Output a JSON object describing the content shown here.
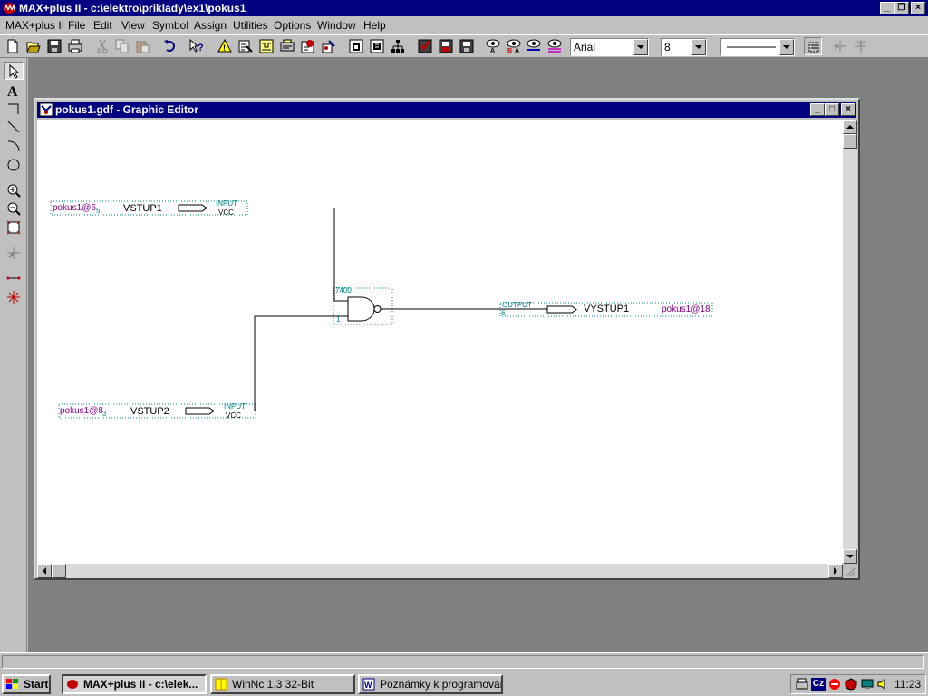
{
  "app": {
    "title": "MAX+plus II - c:\\elektro\\priklady\\ex1\\pokus1"
  },
  "menu": [
    "MAX+plus II",
    "File",
    "Edit",
    "View",
    "Symbol",
    "Assign",
    "Utilities",
    "Options",
    "Window",
    "Help"
  ],
  "toolbar": {
    "font_name": "Arial",
    "font_size": "8",
    "icons": [
      "new-file-icon",
      "open-file-icon",
      "save-icon",
      "print-icon",
      "cut-icon",
      "copy-icon",
      "paste-icon",
      "undo-icon",
      "context-help-icon",
      "compiler-icon",
      "simulator-icon",
      "timing-analyzer-icon",
      "programmer-icon",
      "open-editor-icon",
      "hierarchy-up-icon",
      "hierarchy-down-icon",
      "hierarchy-display-icon",
      "save-check-icon",
      "save-compile-icon",
      "save-simulate-icon",
      "find-node-icon",
      "find-node-design-file-icon",
      "find-node-floorplan-icon",
      "find-node-waveform-icon",
      "line-style-icon",
      "rotate-icon",
      "flip-horizontal-icon",
      "flip-vertical-icon"
    ]
  },
  "palette": {
    "tools": [
      "selection-tool-icon",
      "text-tool-icon",
      "orthogonal-line-icon",
      "diagonal-line-icon",
      "arc-tool-icon",
      "circle-tool-icon",
      "zoom-in-icon",
      "zoom-out-icon",
      "fit-in-window-icon",
      "rubberbanding-icon",
      "connect-tool-icon",
      "cross-tool-icon"
    ]
  },
  "editor": {
    "title": "pokus1.gdf - Graphic Editor",
    "schematic": {
      "inputs": [
        {
          "pin_label": "pokus1@6",
          "pin_num": "5",
          "name": "VSTUP1",
          "type": "INPUT",
          "default": "VCC"
        },
        {
          "pin_label": "pokus1@8",
          "pin_num": "3",
          "name": "VSTUP2",
          "type": "INPUT",
          "default": "VCC"
        }
      ],
      "gate": {
        "name": "7400",
        "pin_a": "1"
      },
      "output": {
        "type": "OUTPUT",
        "pin_num": "6",
        "name": "VYSTUP1",
        "pin_label": "pokus1@18"
      }
    }
  },
  "taskbar": {
    "start": "Start",
    "tasks": [
      "MAX+plus II - c:\\elek...",
      "WinNc 1.3 32-Bit",
      "Poznámky k programování..."
    ],
    "tray_lang": "Cz",
    "clock": "11:23"
  },
  "colors": {
    "title_bar": "#000080",
    "pin_label": "#800080",
    "node_label": "#008080"
  }
}
